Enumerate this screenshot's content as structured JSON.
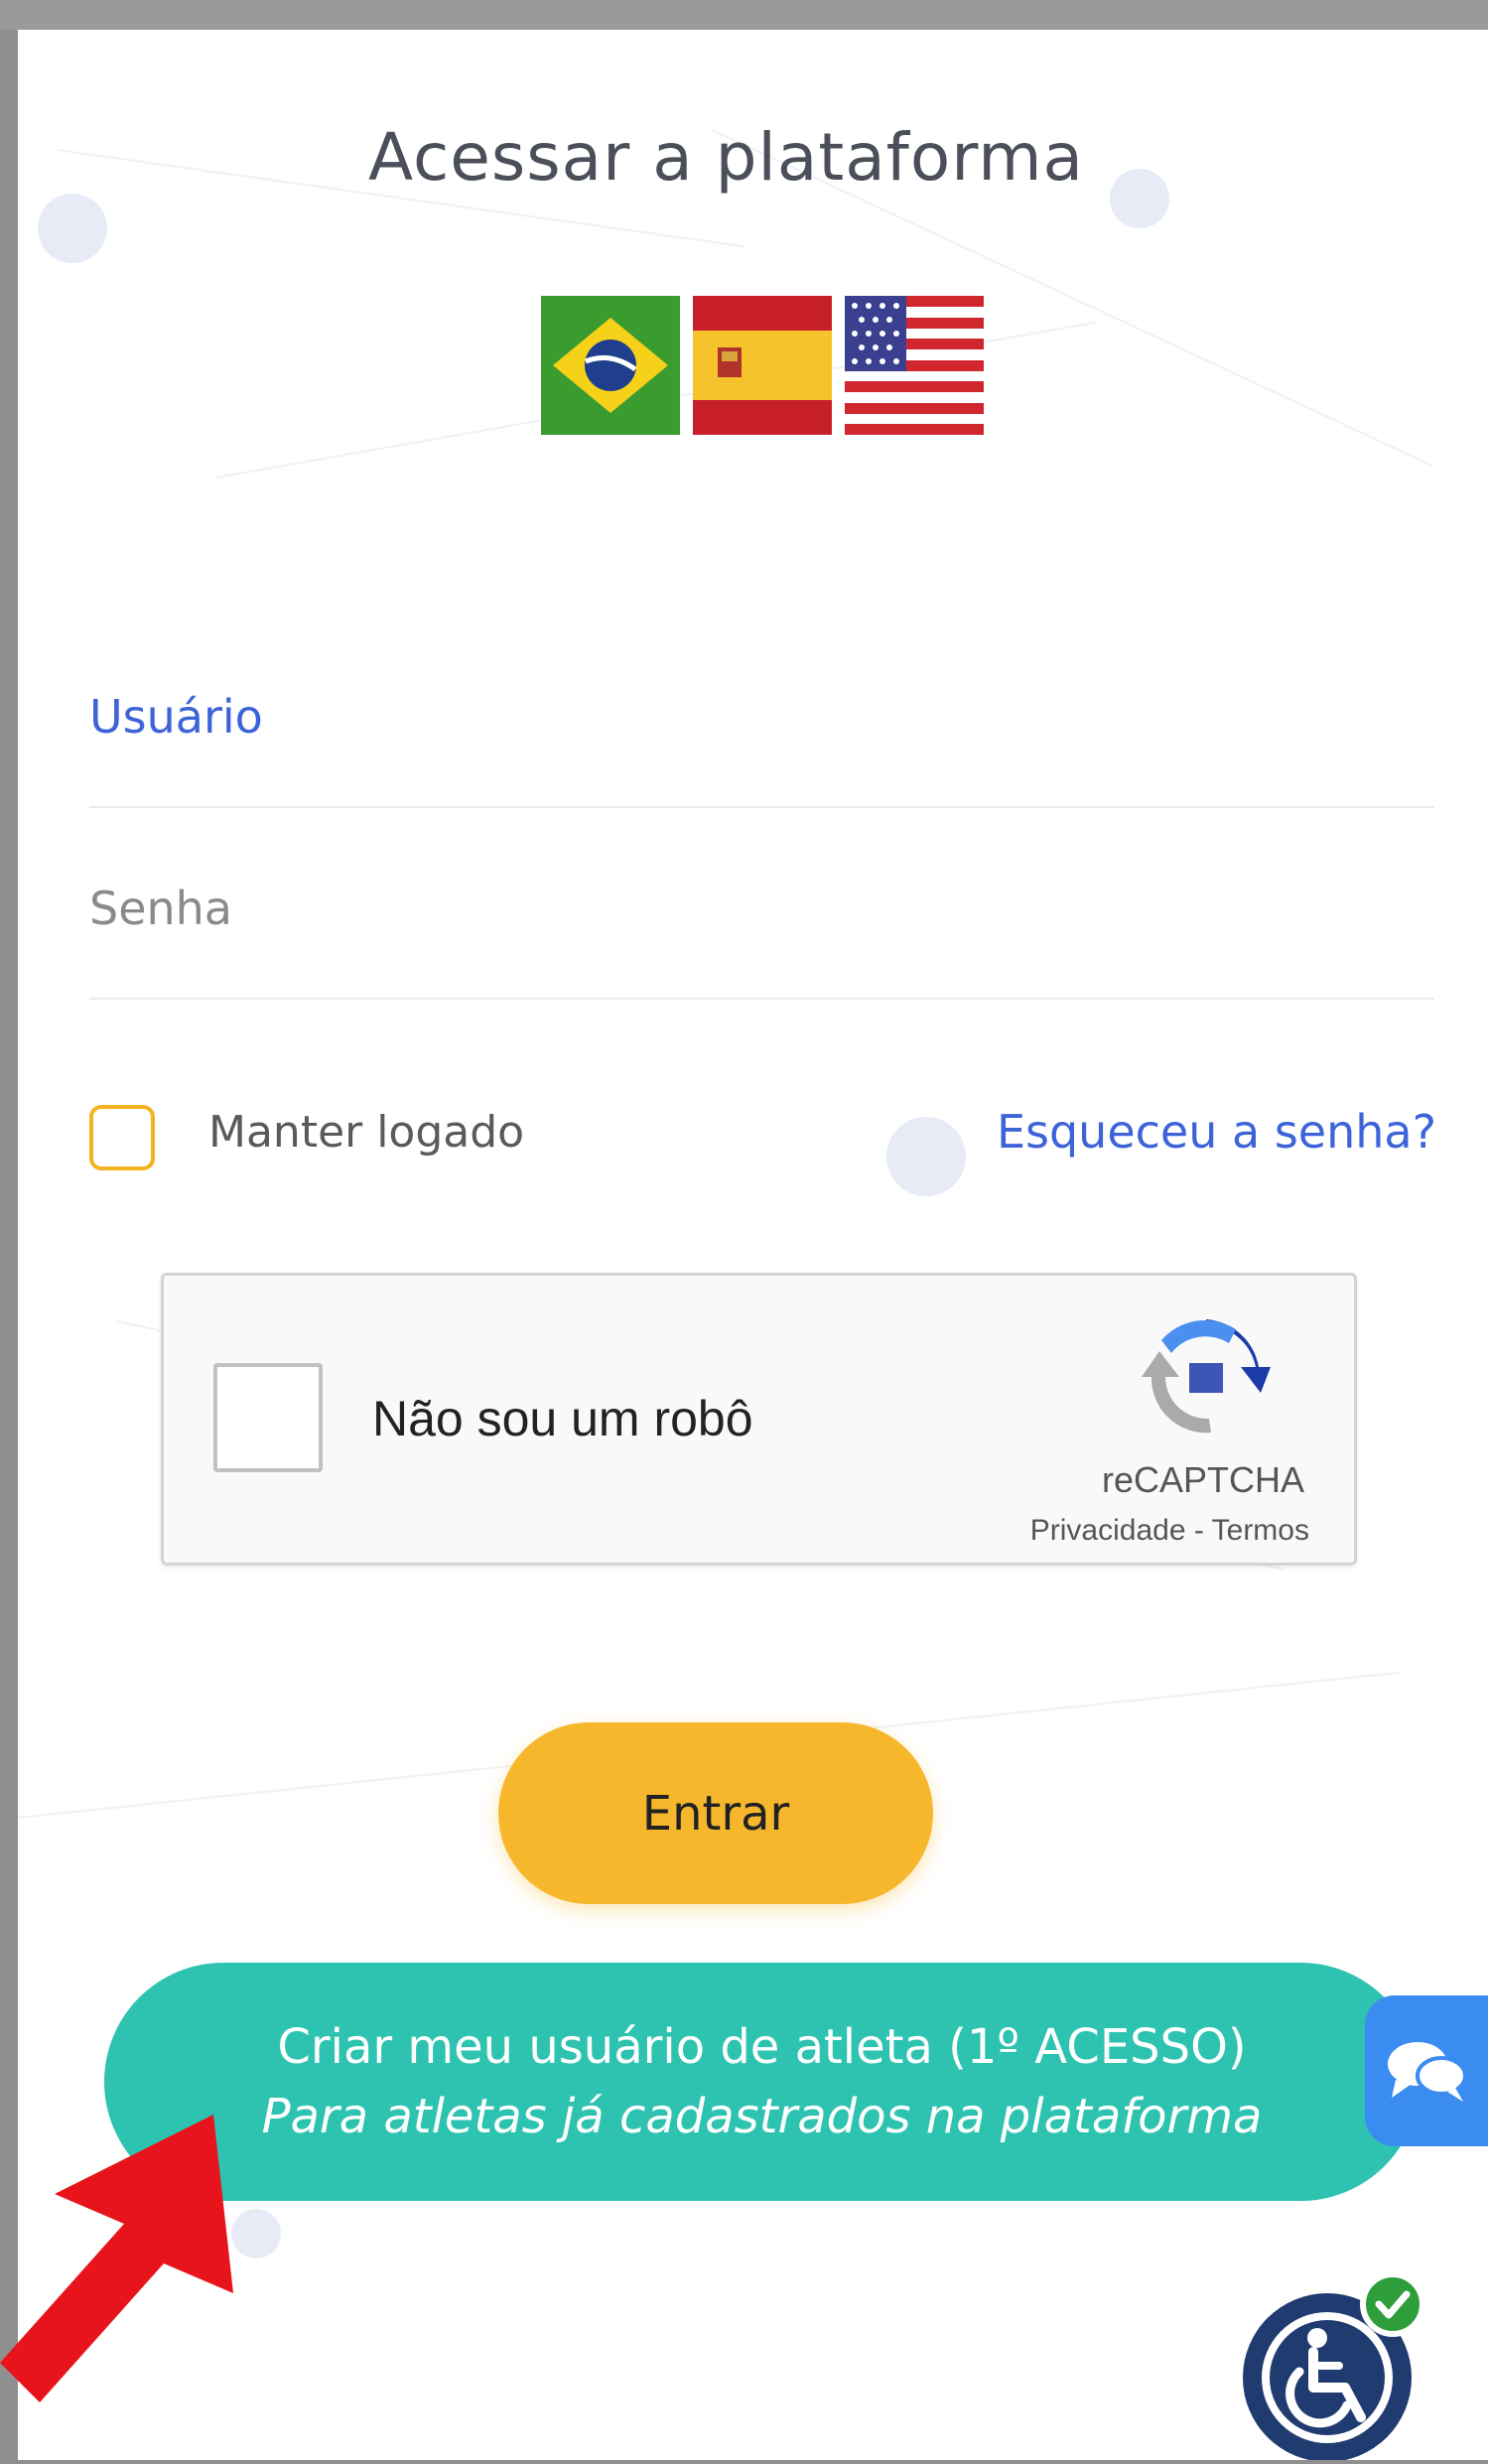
{
  "login": {
    "title": "Acessar a plataforma",
    "languages": [
      {
        "name": "Português (Brasil)",
        "icon": "brazil-flag-icon"
      },
      {
        "name": "Español",
        "icon": "spain-flag-icon"
      },
      {
        "name": "English (US)",
        "icon": "usa-flag-icon"
      }
    ],
    "username_label": "Usuário",
    "password_label": "Senha",
    "keep_logged": "Manter logado",
    "forgot_password": "Esqueceu a senha?",
    "recaptcha": {
      "label": "Não sou um robô",
      "brand": "reCAPTCHA",
      "links": "Privacidade - Termos"
    },
    "submit_label": "Entrar",
    "register": {
      "line1": "Criar meu usuário de atleta (1º ACESSO)",
      "line2": "Para atletas já cadastrados na plataforma"
    }
  },
  "colors": {
    "accent_yellow": "#f7b72c",
    "teal": "#2ec3b0",
    "link_blue": "#3d63d8",
    "chat_blue": "#3b8cf0",
    "arrow_red": "#e8141b",
    "accessibility_navy": "#1f3b6f"
  },
  "icons": [
    "chat-icon",
    "accessibility-icon",
    "red-arrow-icon",
    "recaptcha-logo-icon"
  ]
}
